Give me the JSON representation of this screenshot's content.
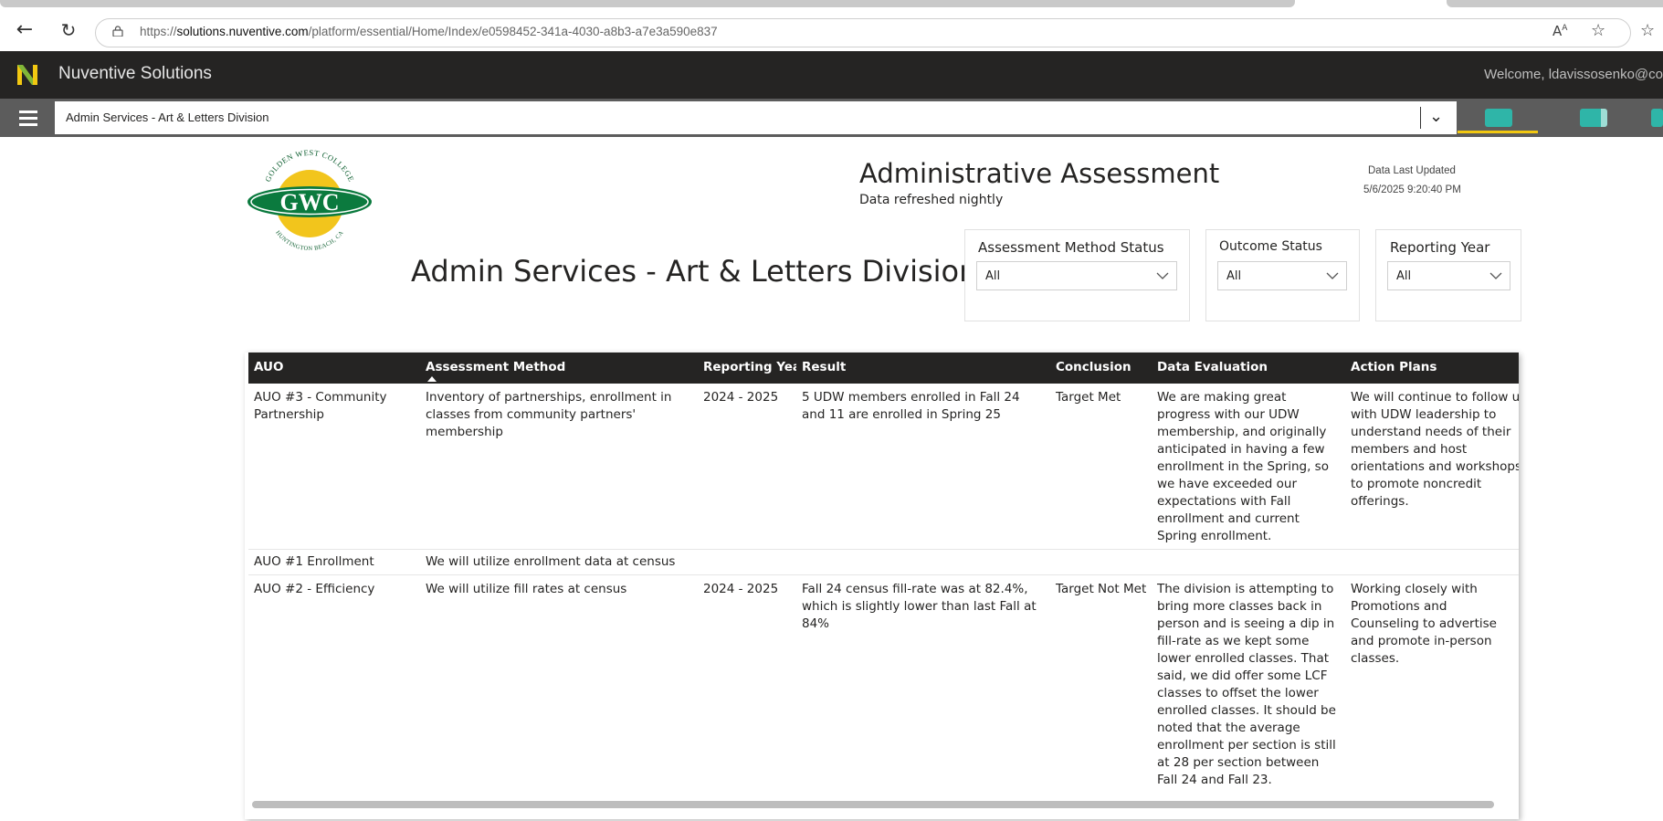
{
  "browser": {
    "url_prefix": "https://",
    "url_domain": "solutions.nuventive.com",
    "url_path": "/platform/essential/Home/Index/e0598452-341a-4030-a8b3-a7e3a590e837"
  },
  "app": {
    "name": "Nuventive Solutions",
    "welcome": "Welcome, ldavissosenko@co",
    "breadcrumb": "Admin Services - Art & Letters Division",
    "accent": "#f2c811",
    "page_button_color": "#2fb5a8"
  },
  "report": {
    "title": "Administrative Assessment",
    "subtitle": "Data refreshed nightly",
    "last_updated_label": "Data Last Updated",
    "last_updated_value": "5/6/2025 9:20:40 PM",
    "division_title": "Admin Services - Art & Letters Division",
    "logo": {
      "top_text": "GOLDEN WEST COLLEGE",
      "center_text": "GWC",
      "bottom_text": "HUNTINGTON BEACH, CA"
    }
  },
  "slicers": [
    {
      "label": "Assessment Method Status",
      "value": "All"
    },
    {
      "label": "Outcome Status",
      "value": "All"
    },
    {
      "label": "Reporting Year",
      "value": "All"
    }
  ],
  "table": {
    "columns": [
      "AUO",
      "Assessment Method",
      "Reporting Year",
      "Result",
      "Conclusion",
      "Data Evaluation",
      "Action Plans"
    ],
    "sorted_column": "Assessment Method",
    "rows": [
      {
        "auo": "AUO #3 - Community Partnership",
        "method": "Inventory of partnerships, enrollment in classes from community partners' membership",
        "year": "2024 - 2025",
        "result": "5 UDW members enrolled in Fall 24 and 11 are enrolled in Spring 25",
        "conclusion": "Target Met",
        "evaluation": "We are making great progress with our UDW membership, and originally anticipated in having a few enrollment in the Spring, so we have exceeded our expectations with Fall enrollment and current Spring enrollment.",
        "actions": "We will continue to follow up with UDW leadership to understand needs of their members and host orientations and workshops to promote noncredit offerings."
      },
      {
        "auo": "AUO #1 Enrollment",
        "method": "We will utilize enrollment data at census",
        "year": "",
        "result": "",
        "conclusion": "",
        "evaluation": "",
        "actions": ""
      },
      {
        "auo": "AUO #2 - Efficiency",
        "method": "We will utilize fill rates at census",
        "year": "2024 - 2025",
        "result": "Fall 24 census fill-rate was at 82.4%, which is slightly lower than last Fall at 84%",
        "conclusion": "Target Not Met",
        "evaluation": "The division is attempting to bring more classes back in person and is seeing a dip in fill-rate as we kept some lower enrolled classes. That said, we did offer some LCF classes to offset the lower enrolled classes. It should be noted that the average enrollment per section is still at 28 per section between Fall 24 and Fall 23.",
        "actions": "Working closely with Promotions and Counseling to advertise and promote in-person classes."
      }
    ]
  }
}
